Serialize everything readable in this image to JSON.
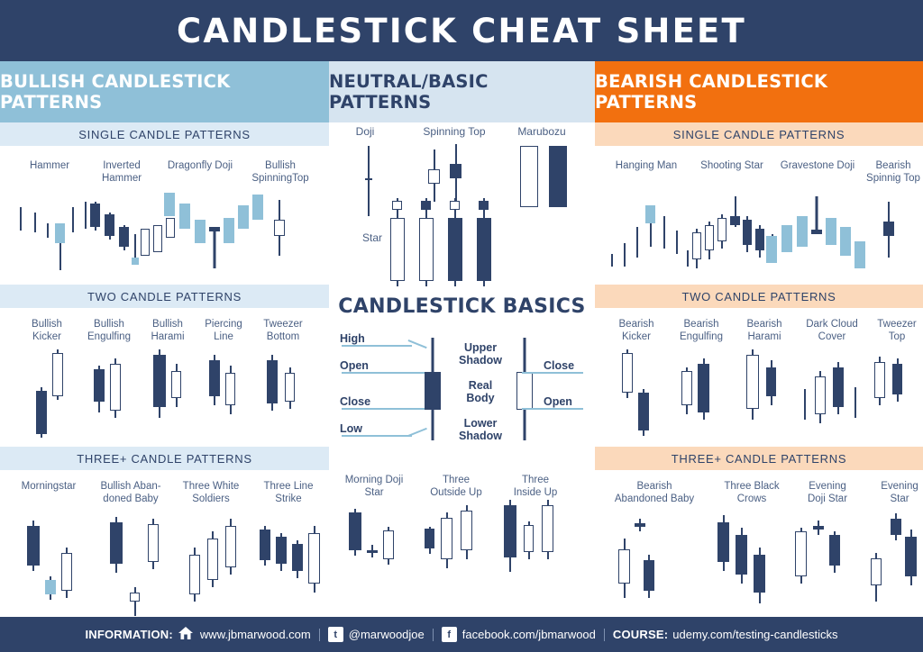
{
  "title": "CANDLESTICK CHEAT SHEET",
  "colors": {
    "navy": "#2f4369",
    "bullish_header": "#8fc0d8",
    "neutral_header": "#d6e4f0",
    "bearish_header": "#f2700f",
    "bull_band": "#dceaf5",
    "bear_band": "#fbd9bb",
    "candle_dark": "#2f4369",
    "candle_light_blue": "#8fc0d8",
    "candle_white": "#ffffff"
  },
  "columns": {
    "bullish": {
      "header": "BULLISH CANDLESTICK PATTERNS",
      "sections": [
        {
          "band": "SINGLE CANDLE PATTERNS",
          "patterns": [
            "Hammer",
            "Inverted\nHammer",
            "Dragonfly Doji",
            "Bullish\nSpinningTop"
          ]
        },
        {
          "band": "TWO CANDLE PATTERNS",
          "patterns": [
            "Bullish\nKicker",
            "Bullish\nEngulfing",
            "Bullish\nHarami",
            "Piercing\nLine",
            "Tweezer\nBottom"
          ]
        },
        {
          "band": "THREE+ CANDLE PATTERNS",
          "patterns": [
            "Morningstar",
            "Bullish Aban-\ndoned Baby",
            "Three White\nSoldiers",
            "Three Line\nStrike"
          ]
        }
      ]
    },
    "neutral": {
      "header": "NEUTRAL/BASIC PATTERNS",
      "top_labels": [
        "Doji",
        "Spinning Top",
        "Marubozu",
        "Star"
      ],
      "basics_title": "CANDLESTICK BASICS",
      "basics_labels": {
        "high": "High",
        "open": "Open",
        "close": "Close",
        "low": "Low",
        "upper_shadow": "Upper\nShadow",
        "real_body": "Real\nBody",
        "lower_shadow": "Lower\nShadow",
        "right_close": "Close",
        "right_open": "Open"
      },
      "bottom_patterns": [
        "Morning Doji\nStar",
        "Three\nOutside Up",
        "Three\nInside Up"
      ]
    },
    "bearish": {
      "header": "BEARISH CANDLESTICK PATTERNS",
      "sections": [
        {
          "band": "SINGLE CANDLE PATTERNS",
          "patterns": [
            "Hanging Man",
            "Shooting Star",
            "Gravestone Doji",
            "Bearish\nSpinnig Top"
          ]
        },
        {
          "band": "TWO CANDLE PATTERNS",
          "patterns": [
            "Bearish\nKicker",
            "Bearish\nEngulfing",
            "Bearish\nHarami",
            "Dark Cloud\nCover",
            "Tweezer\nTop"
          ]
        },
        {
          "band": "THREE+ CANDLE PATTERNS",
          "patterns": [
            "Bearish\nAbandoned Baby",
            "Three Black\nCrows",
            "Evening\nDoji Star",
            "Evening\nStar"
          ]
        }
      ]
    }
  },
  "footer": {
    "information_label": "INFORMATION:",
    "home_icon": "house-icon",
    "website": "www.jbmarwood.com",
    "twitter_icon": "twitter-icon",
    "twitter": "@marwoodjoe",
    "facebook_icon": "facebook-icon",
    "facebook": "facebook.com/jbmarwood",
    "course_label": "COURSE:",
    "course": "udemy.com/testing-candlesticks"
  }
}
